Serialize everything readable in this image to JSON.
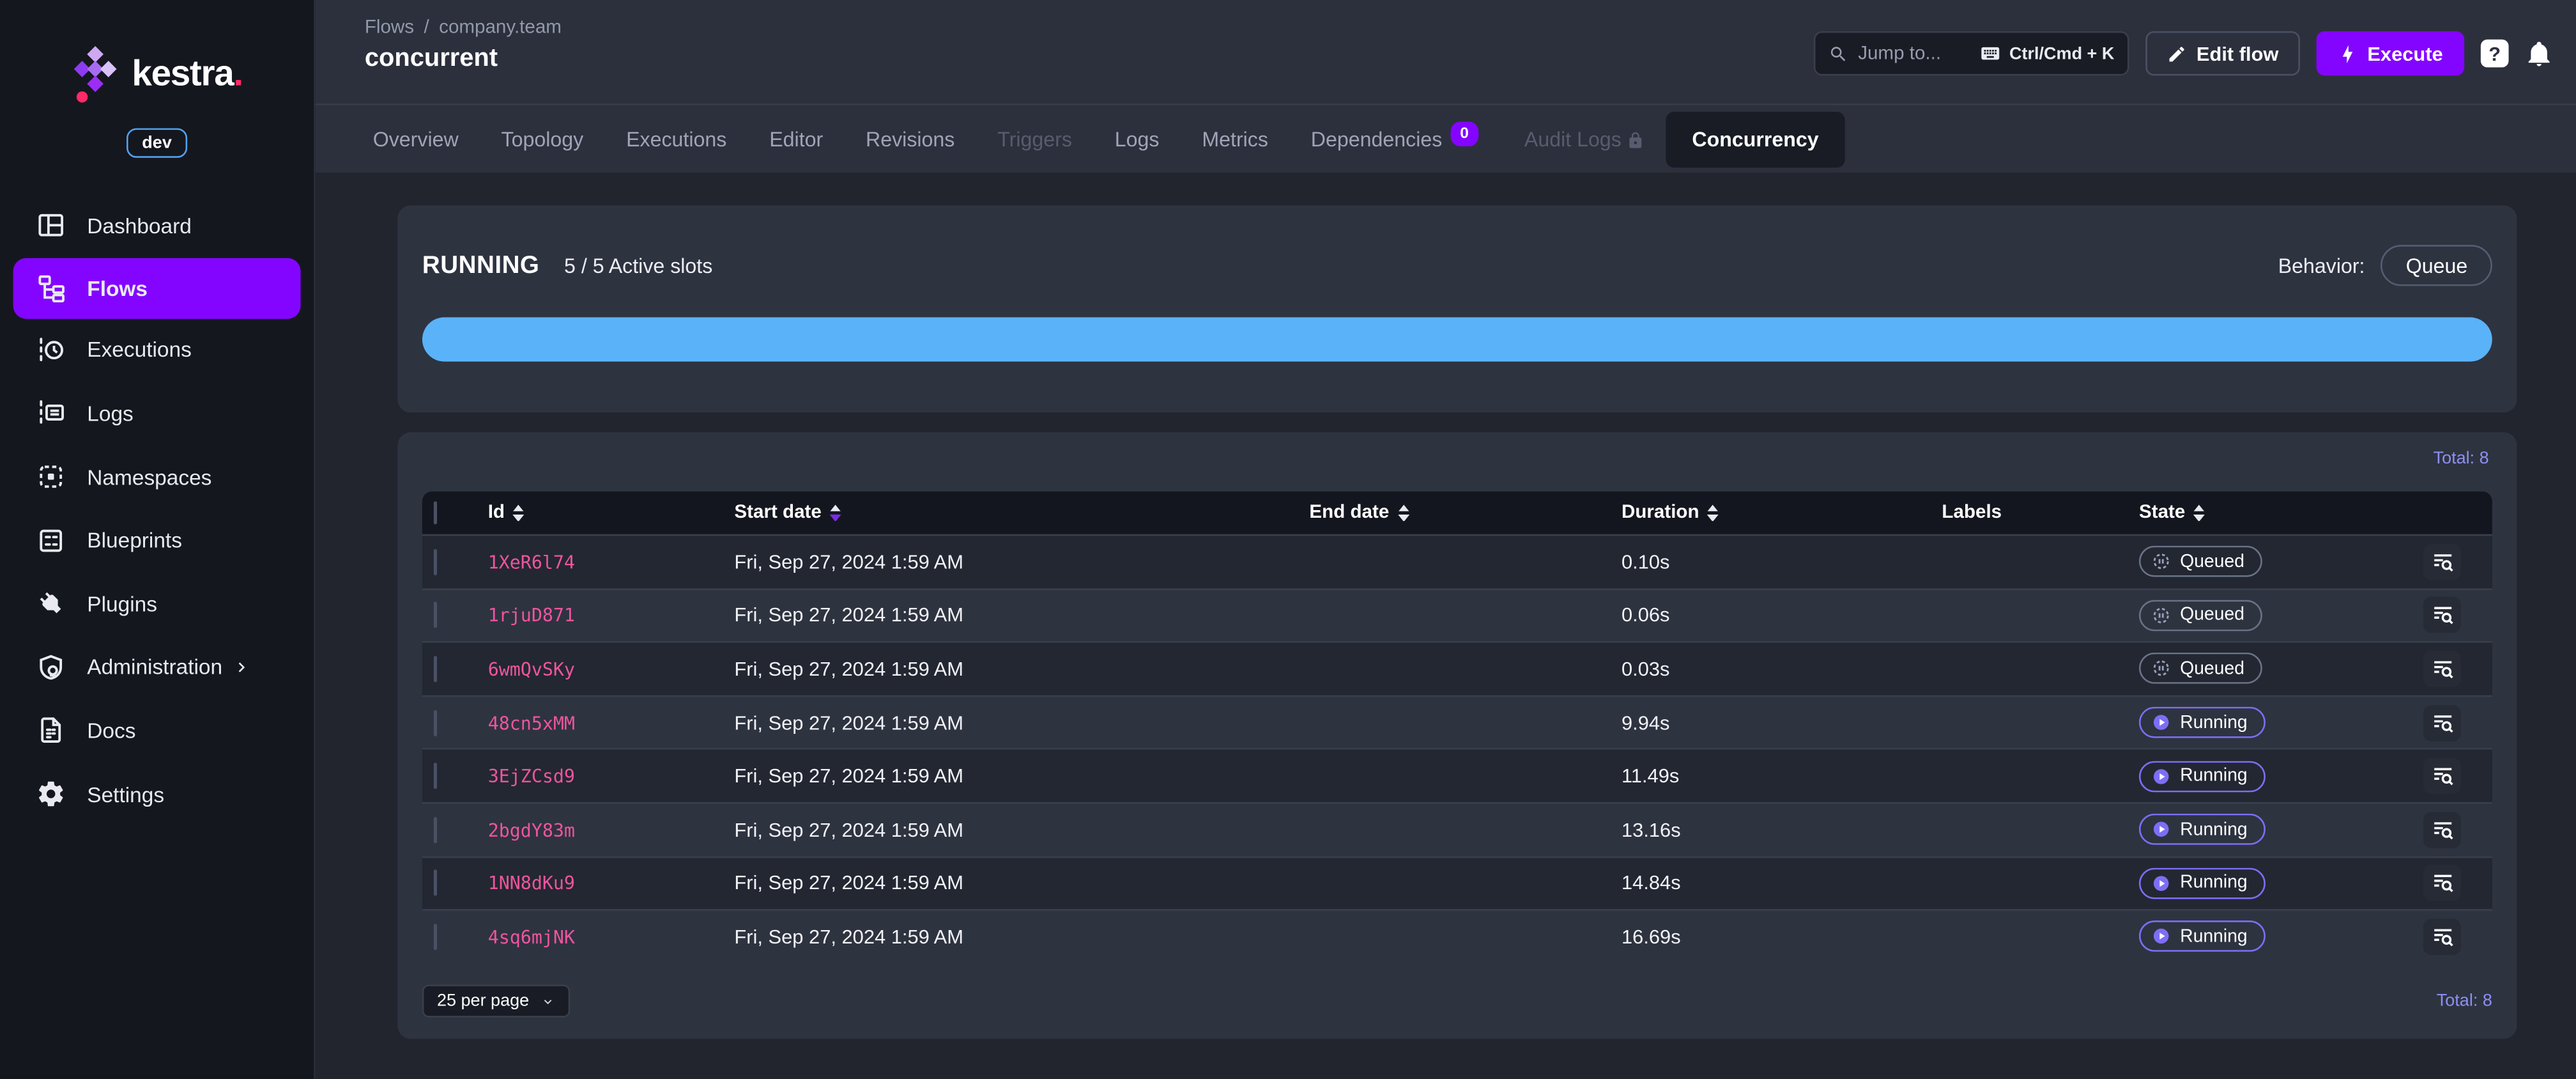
{
  "sidebar": {
    "logo_text": "kestra",
    "logo_dot": ".",
    "env_badge": "dev",
    "items": [
      {
        "label": "Dashboard"
      },
      {
        "label": "Flows",
        "active": true
      },
      {
        "label": "Executions"
      },
      {
        "label": "Logs"
      },
      {
        "label": "Namespaces"
      },
      {
        "label": "Blueprints"
      },
      {
        "label": "Plugins"
      },
      {
        "label": "Administration",
        "expandable": true
      },
      {
        "label": "Docs"
      },
      {
        "label": "Settings"
      }
    ]
  },
  "header": {
    "breadcrumb": {
      "root": "Flows",
      "separator": "/",
      "namespace": "company.team"
    },
    "title": "concurrent",
    "search": {
      "placeholder": "Jump to...",
      "shortcut": "Ctrl/Cmd + K"
    },
    "edit_flow_label": "Edit flow",
    "execute_label": "Execute",
    "help_label": "?"
  },
  "tabs": [
    {
      "label": "Overview"
    },
    {
      "label": "Topology"
    },
    {
      "label": "Executions"
    },
    {
      "label": "Editor"
    },
    {
      "label": "Revisions"
    },
    {
      "label": "Triggers",
      "disabled": true
    },
    {
      "label": "Logs"
    },
    {
      "label": "Metrics"
    },
    {
      "label": "Dependencies",
      "badge": "0"
    },
    {
      "label": "Audit Logs",
      "locked": true
    },
    {
      "label": "Concurrency",
      "active": true
    }
  ],
  "concurrency": {
    "state_title": "RUNNING",
    "slots_text": "5 / 5 Active slots",
    "slots_used": 5,
    "slots_total": 5,
    "behavior_label": "Behavior:",
    "behavior_value": "Queue",
    "progress_percent": 100
  },
  "table": {
    "total_label": "Total: 8",
    "columns": [
      "Id",
      "Start date",
      "End date",
      "Duration",
      "Labels",
      "State"
    ],
    "sort": {
      "column": "Start date",
      "direction": "desc"
    },
    "rows": [
      {
        "id": "1XeR6l74",
        "start_date": "Fri, Sep 27, 2024 1:59 AM",
        "end_date": "",
        "duration": "0.10s",
        "labels": "",
        "state": "Queued"
      },
      {
        "id": "1rjuD871",
        "start_date": "Fri, Sep 27, 2024 1:59 AM",
        "end_date": "",
        "duration": "0.06s",
        "labels": "",
        "state": "Queued"
      },
      {
        "id": "6wmQvSKy",
        "start_date": "Fri, Sep 27, 2024 1:59 AM",
        "end_date": "",
        "duration": "0.03s",
        "labels": "",
        "state": "Queued"
      },
      {
        "id": "48cn5xMM",
        "start_date": "Fri, Sep 27, 2024 1:59 AM",
        "end_date": "",
        "duration": "9.94s",
        "labels": "",
        "state": "Running"
      },
      {
        "id": "3EjZCsd9",
        "start_date": "Fri, Sep 27, 2024 1:59 AM",
        "end_date": "",
        "duration": "11.49s",
        "labels": "",
        "state": "Running"
      },
      {
        "id": "2bgdY83m",
        "start_date": "Fri, Sep 27, 2024 1:59 AM",
        "end_date": "",
        "duration": "13.16s",
        "labels": "",
        "state": "Running"
      },
      {
        "id": "1NN8dKu9",
        "start_date": "Fri, Sep 27, 2024 1:59 AM",
        "end_date": "",
        "duration": "14.84s",
        "labels": "",
        "state": "Running"
      },
      {
        "id": "4sq6mjNK",
        "start_date": "Fri, Sep 27, 2024 1:59 AM",
        "end_date": "",
        "duration": "16.69s",
        "labels": "",
        "state": "Running"
      }
    ],
    "pagination": {
      "per_page": "25 per page"
    }
  },
  "colors": {
    "accent_purple": "#8405ff",
    "id_pink": "#ee559e",
    "progress_blue": "#5ab2f8",
    "total_periwinkle": "#8d90f2",
    "running_icon": "#7d6ef5",
    "queued_icon": "#98a1bb"
  }
}
